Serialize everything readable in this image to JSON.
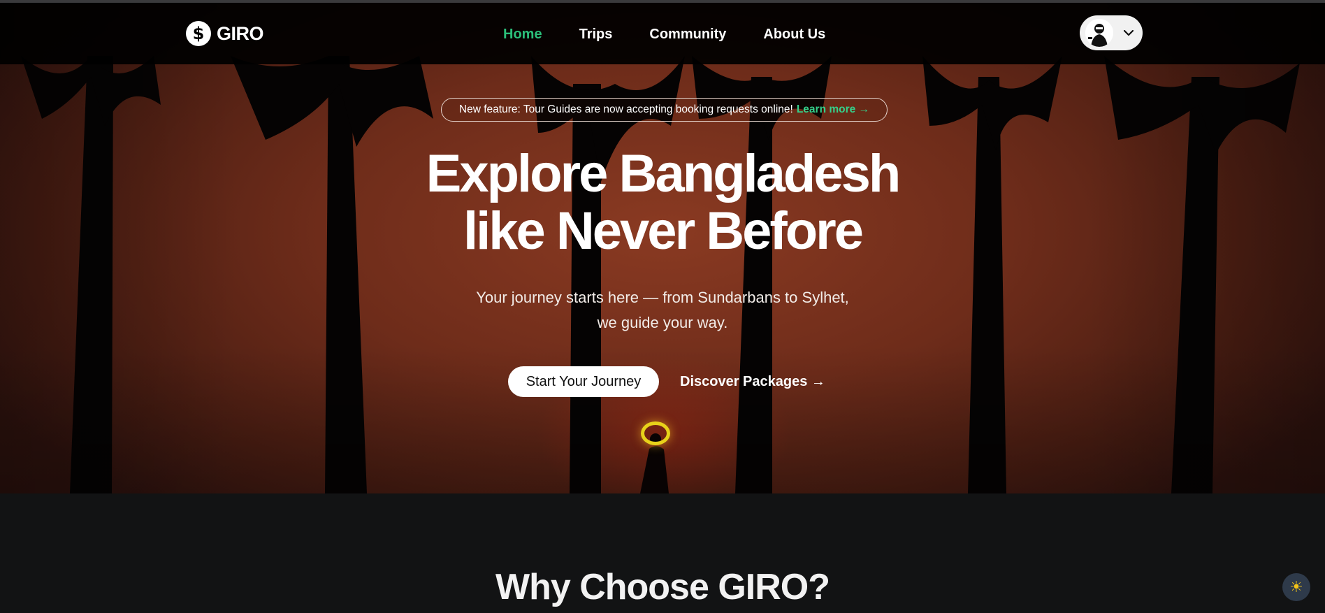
{
  "colors": {
    "accent": "#2bbf7a",
    "learn_more": "#35d08a",
    "hero_sky": "#7a3320",
    "halo": "#e8d21a"
  },
  "brand": {
    "logo_glyph": "$",
    "name": "GIRO"
  },
  "nav": {
    "links": [
      {
        "label": "Home",
        "active": true
      },
      {
        "label": "Trips",
        "active": false
      },
      {
        "label": "Community",
        "active": false
      },
      {
        "label": "About Us",
        "active": false
      }
    ],
    "user_menu": {
      "avatar_icon": "avatar",
      "caret_icon": "chevron-down-icon"
    }
  },
  "announcement": {
    "text": "New feature: Tour Guides are now accepting booking requests online!",
    "link": "Learn more →"
  },
  "hero": {
    "title_line1": "Explore Bangladesh",
    "title_line2": "like Never Before",
    "subtitle_line1": "Your journey starts here — from Sundarbans to Sylhet,",
    "subtitle_line2": "we guide your way.",
    "primary_cta": "Start Your Journey",
    "secondary_cta": "Discover Packages →"
  },
  "why": {
    "title": "Why Choose GIRO?"
  },
  "theme_toggle": {
    "icon": "sun-icon",
    "glyph": "☀"
  }
}
